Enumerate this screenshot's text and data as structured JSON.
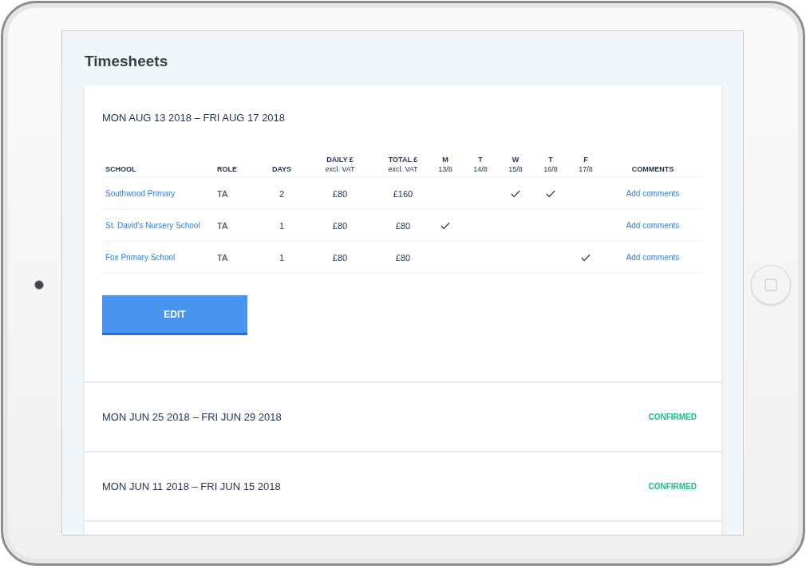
{
  "page": {
    "title": "Timesheets"
  },
  "weeks": [
    {
      "date_range": "MON AUG 13 2018 – FRI AUG 17 2018",
      "table": {
        "columns": [
          {
            "label": "SCHOOL"
          },
          {
            "label": "ROLE"
          },
          {
            "label": "DAYS"
          },
          {
            "label": "DAILY £",
            "sub": "excl. VAT"
          },
          {
            "label": "TOTAL £",
            "sub": "excl. VAT"
          },
          {
            "label": "M",
            "sub": "13/8"
          },
          {
            "label": "T",
            "sub": "14/8"
          },
          {
            "label": "W",
            "sub": "15/8"
          },
          {
            "label": "T",
            "sub": "16/8"
          },
          {
            "label": "F",
            "sub": "17/8"
          },
          {
            "label": "COMMENTS"
          }
        ],
        "rows": [
          {
            "school": "Southwood Primary",
            "role": "TA",
            "days": "2",
            "daily": "£80",
            "total": "£160",
            "worked": [
              false,
              false,
              true,
              true,
              false
            ],
            "comments": "Add comments"
          },
          {
            "school": "St. David's Nursery School",
            "role": "TA",
            "days": "1",
            "daily": "£80",
            "total": "£80",
            "worked": [
              true,
              false,
              false,
              false,
              false
            ],
            "comments": "Add comments"
          },
          {
            "school": "Fox Primary School",
            "role": "TA",
            "days": "1",
            "daily": "£80",
            "total": "£80",
            "worked": [
              false,
              false,
              false,
              false,
              true
            ],
            "comments": "Add comments"
          }
        ]
      },
      "button": "EDIT"
    },
    {
      "date_range": "MON JUN 25 2018 – FRI JUN 29 2018",
      "status": "CONFIRMED"
    },
    {
      "date_range": "MON JUN 11 2018 – FRI JUN 15 2018",
      "status": "CONFIRMED"
    }
  ]
}
